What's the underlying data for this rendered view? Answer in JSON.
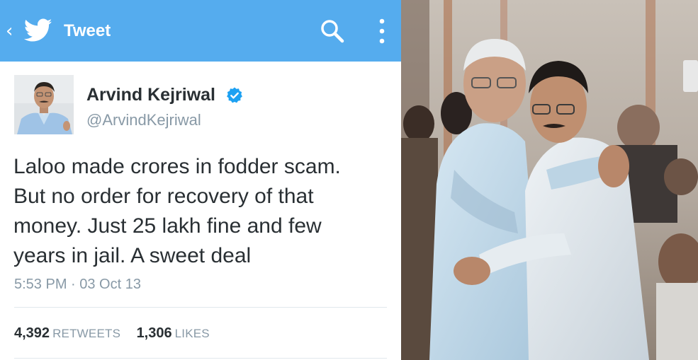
{
  "app_bar": {
    "title": "Tweet",
    "color": "#55acee",
    "icons": [
      "back-icon",
      "twitter-bird-icon",
      "search-icon",
      "more-vert-icon"
    ]
  },
  "tweet": {
    "author_name": "Arvind Kejriwal",
    "author_handle": "@ArvindKejriwal",
    "verified": true,
    "text_lines": [
      "Laloo made crores in fodder scam.",
      "But no order for recovery of that",
      "money. Just 25 lakh fine and few",
      "years in jail. A sweet deal"
    ],
    "timestamp": "5:53 PM · 03 Oct 13",
    "retweets": {
      "count": "4,392",
      "label": "RETWEETS"
    },
    "likes": {
      "count": "1,306",
      "label": "LIKES"
    }
  },
  "colors": {
    "brand_blue": "#55acee",
    "text_primary": "#292f33",
    "text_secondary": "#8899a6",
    "divider": "#e1e8ed",
    "verified_badge": "#1da1f2"
  }
}
